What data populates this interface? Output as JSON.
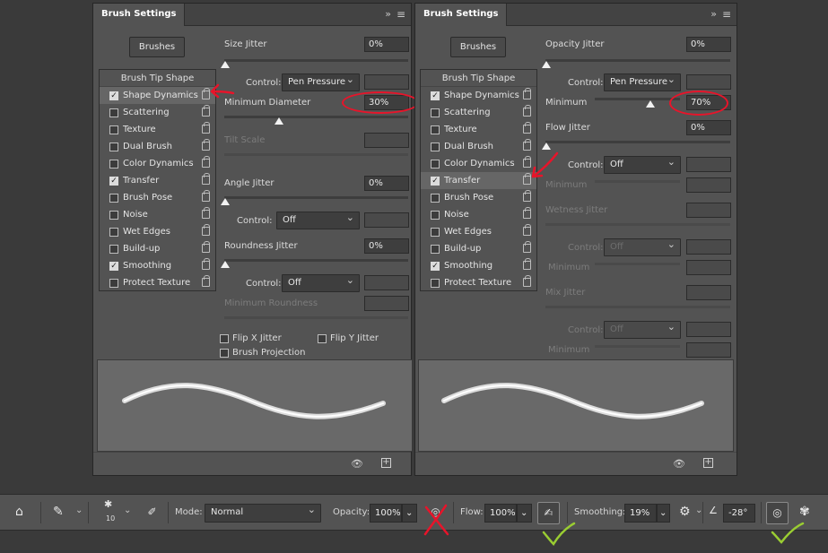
{
  "left_panel": {
    "tab": "Brush Settings",
    "brushes_button": "Brushes",
    "brush_tip_shape": "Brush Tip Shape",
    "items": [
      {
        "label": "Shape Dynamics",
        "checked": true,
        "selected": true
      },
      {
        "label": "Scattering",
        "checked": false
      },
      {
        "label": "Texture",
        "checked": false
      },
      {
        "label": "Dual Brush",
        "checked": false
      },
      {
        "label": "Color Dynamics",
        "checked": false
      },
      {
        "label": "Transfer",
        "checked": true
      },
      {
        "label": "Brush Pose",
        "checked": false
      },
      {
        "label": "Noise",
        "checked": false
      },
      {
        "label": "Wet Edges",
        "checked": false
      },
      {
        "label": "Build-up",
        "checked": false
      },
      {
        "label": "Smoothing",
        "checked": true
      },
      {
        "label": "Protect Texture",
        "checked": false
      }
    ],
    "size_jitter": {
      "label": "Size Jitter",
      "value": "0%"
    },
    "control_label": "Control:",
    "control_1": "Pen Pressure",
    "min_diameter": {
      "label": "Minimum Diameter",
      "value": "30%"
    },
    "tilt_scale": "Tilt Scale",
    "angle_jitter": {
      "label": "Angle Jitter",
      "value": "0%"
    },
    "control_2": "Off",
    "roundness_jitter": {
      "label": "Roundness Jitter",
      "value": "0%"
    },
    "control_3": "Off",
    "min_roundness": "Minimum Roundness",
    "flip_x": "Flip X Jitter",
    "flip_y": "Flip Y Jitter",
    "brush_projection": "Brush Projection"
  },
  "right_panel": {
    "tab": "Brush Settings",
    "brushes_button": "Brushes",
    "brush_tip_shape": "Brush Tip Shape",
    "items": [
      {
        "label": "Shape Dynamics",
        "checked": true
      },
      {
        "label": "Scattering",
        "checked": false
      },
      {
        "label": "Texture",
        "checked": false
      },
      {
        "label": "Dual Brush",
        "checked": false
      },
      {
        "label": "Color Dynamics",
        "checked": false
      },
      {
        "label": "Transfer",
        "checked": true,
        "selected": true
      },
      {
        "label": "Brush Pose",
        "checked": false
      },
      {
        "label": "Noise",
        "checked": false
      },
      {
        "label": "Wet Edges",
        "checked": false
      },
      {
        "label": "Build-up",
        "checked": false
      },
      {
        "label": "Smoothing",
        "checked": true
      },
      {
        "label": "Protect Texture",
        "checked": false
      }
    ],
    "opacity_jitter": {
      "label": "Opacity Jitter",
      "value": "0%"
    },
    "control_label": "Control:",
    "control_1": "Pen Pressure",
    "minimum": {
      "label": "Minimum",
      "value": "70%"
    },
    "flow_jitter": {
      "label": "Flow Jitter",
      "value": "0%"
    },
    "control_2": "Off",
    "minimum_2": "Minimum",
    "wetness_jitter": "Wetness Jitter",
    "control_3": "Off",
    "minimum_3": "Minimum",
    "mix_jitter": "Mix Jitter",
    "control_4": "Off",
    "minimum_4": "Minimum"
  },
  "toolbar": {
    "brush_size": "10",
    "mode_label": "Mode:",
    "mode_value": "Normal",
    "opacity_label": "Opacity:",
    "opacity_value": "100%",
    "flow_label": "Flow:",
    "flow_value": "100%",
    "smoothing_label": "Smoothing:",
    "smoothing_value": "19%",
    "angle_value": "-28°"
  },
  "colors": {
    "panel_bg": "#535353",
    "annotation_red": "#e8142a",
    "annotation_green": "#9acd32"
  }
}
